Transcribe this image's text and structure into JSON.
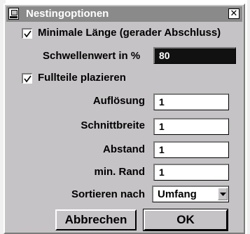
{
  "window": {
    "title": "Nestingoptionen",
    "close_glyph": "✕"
  },
  "options": {
    "min_length_label": "Minimale Länge (gerader Abschluss)",
    "min_length_checked": true,
    "threshold_label": "Schwellenwert in %",
    "threshold_value": "80",
    "filler_label": "Fullteile plazieren",
    "filler_checked": true
  },
  "fields": [
    {
      "label": "Auflösung",
      "value": "1"
    },
    {
      "label": "Schnittbreite",
      "value": "1"
    },
    {
      "label": "Abstand",
      "value": "1"
    },
    {
      "label": "min. Rand",
      "value": "1"
    }
  ],
  "sort": {
    "label": "Sortieren nach",
    "value": "Umfang"
  },
  "buttons": {
    "cancel": "Abbrechen",
    "ok": "OK"
  },
  "icons": {
    "app": "application-icon",
    "close": "close-icon",
    "check": "check-icon",
    "dropdown": "chevron-down-icon"
  }
}
